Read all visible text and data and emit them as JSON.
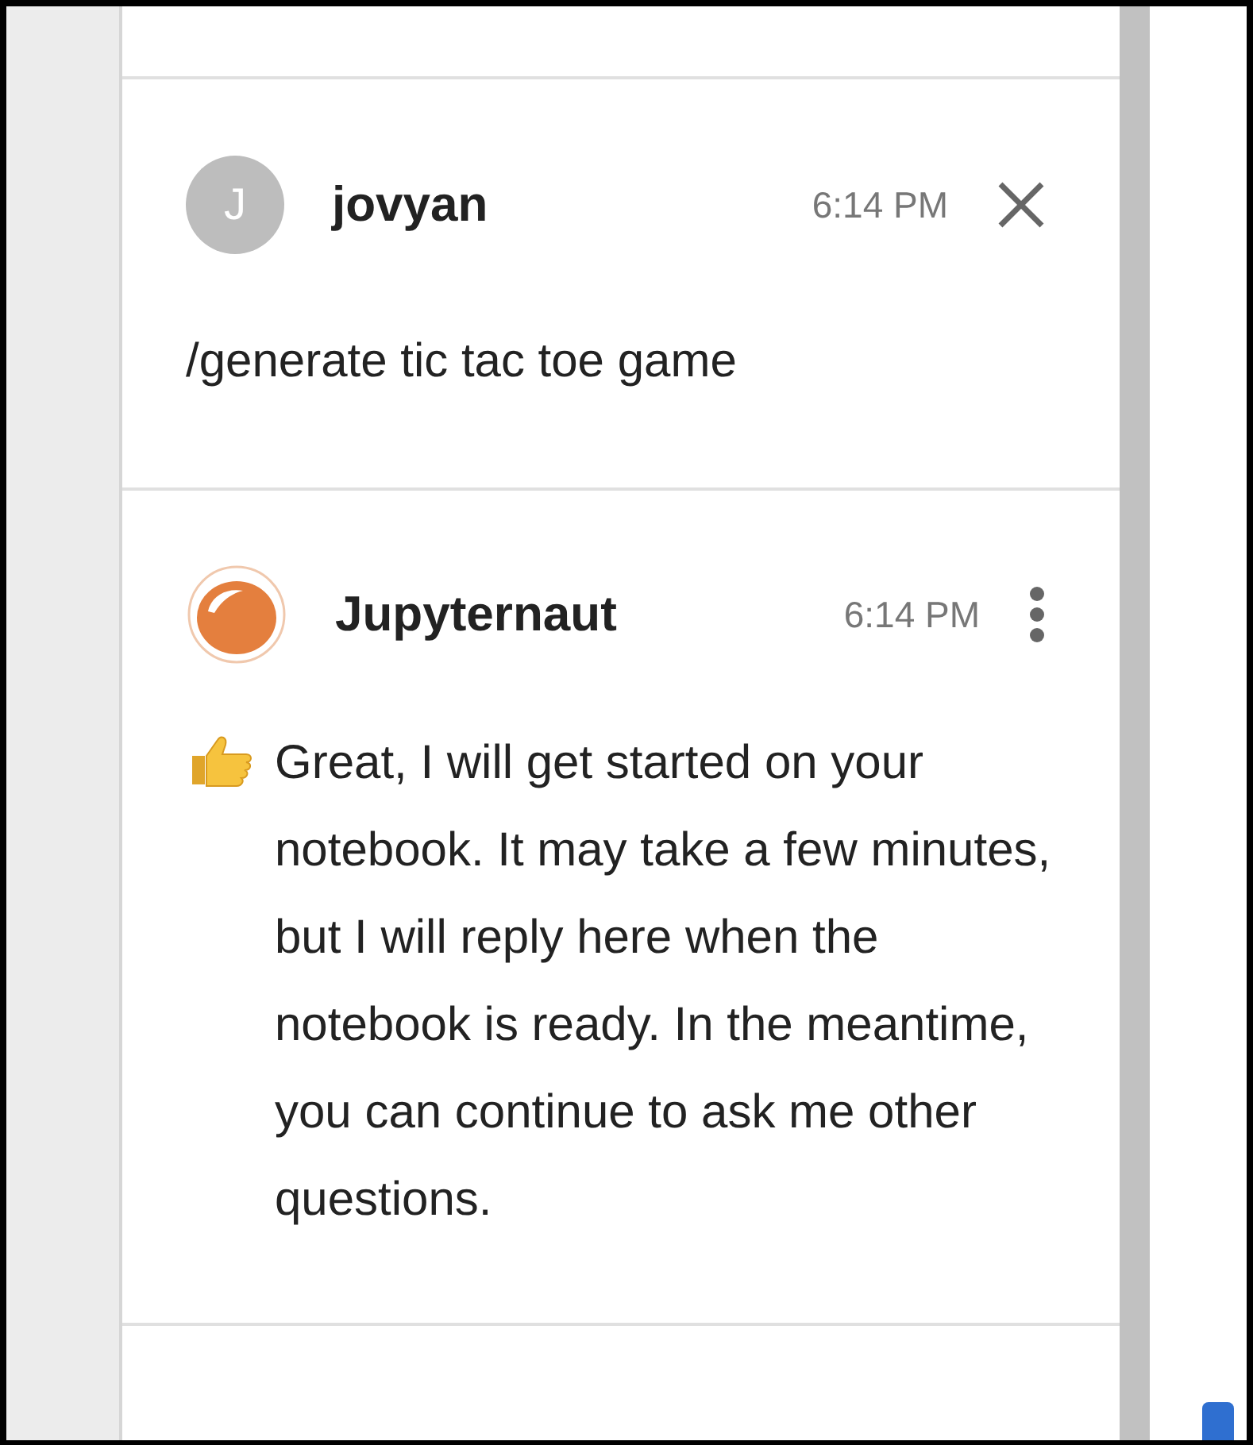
{
  "messages": [
    {
      "kind": "user",
      "avatar": "J",
      "sender": "jovyan",
      "time": "6:14 PM",
      "body": "/generate tic tac toe game"
    },
    {
      "kind": "bot",
      "sender": "Jupyternaut",
      "time": "6:14 PM",
      "body": "Great, I will get started on your notebook. It may take a few minutes, but I will reply here when the notebook is ready. In the meantime, you can continue to ask me other questions."
    }
  ]
}
